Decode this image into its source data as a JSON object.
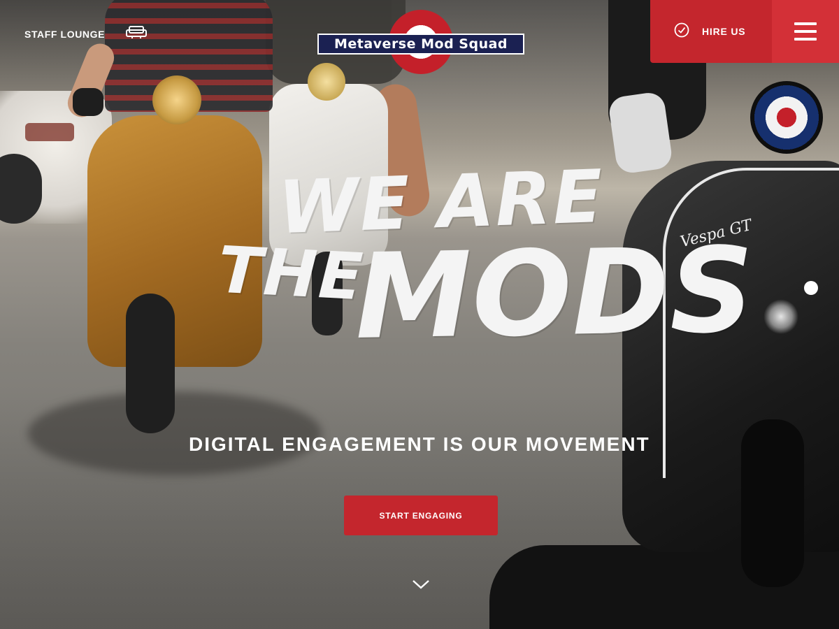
{
  "header": {
    "staff_lounge_label": "STAFF LOUNGE",
    "staff_lounge_icon": "sofa-icon",
    "logo_text": "Metaverse Mod Squad",
    "hire_us_label": "HIRE US",
    "hire_us_icon": "check-circle-icon",
    "menu_icon": "hamburger-menu-icon"
  },
  "hero": {
    "headline_line1": "WE ARE",
    "headline_line2": "THE",
    "headline_line3": "MODS",
    "tagline": "DIGITAL ENGAGEMENT IS OUR MOVEMENT",
    "cta_label": "START ENGAGING",
    "scroll_icon": "chevron-down-icon"
  },
  "colors": {
    "accent_red": "#c4262d",
    "menu_red": "#d33037",
    "logo_navy": "#1b2152",
    "text_white": "#ffffff"
  }
}
